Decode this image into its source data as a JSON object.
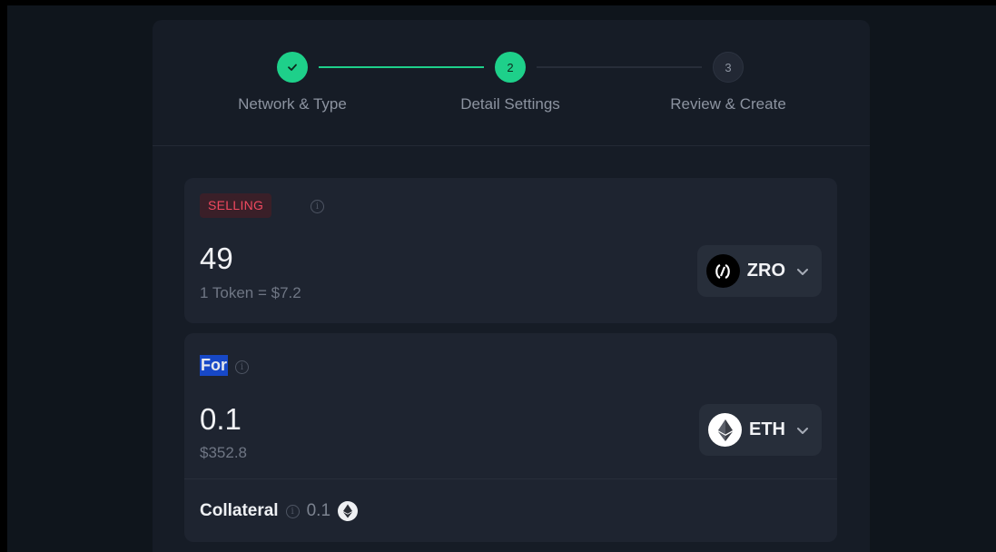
{
  "stepper": {
    "steps": [
      {
        "label": "Network & Type",
        "state": "done"
      },
      {
        "label": "Detail Settings",
        "number": "2",
        "state": "active"
      },
      {
        "label": "Review & Create",
        "number": "3",
        "state": "pending"
      }
    ]
  },
  "selling": {
    "badge": "SELLING",
    "amount": "49",
    "rate": "1 Token = $7.2",
    "token": {
      "symbol": "ZRO",
      "icon": "layerzero-logo-icon"
    }
  },
  "for": {
    "label": "For",
    "amount": "0.1",
    "usd_value": "$352.8",
    "token": {
      "symbol": "ETH",
      "icon": "ethereum-logo-icon"
    },
    "collateral": {
      "label": "Collateral",
      "value": "0.1",
      "icon": "ethereum-logo-icon"
    }
  },
  "colors": {
    "accent": "#1ed08a",
    "badge_text": "#f0495f",
    "panel_bg": "#161c26",
    "card_bg": "#1e2430"
  }
}
